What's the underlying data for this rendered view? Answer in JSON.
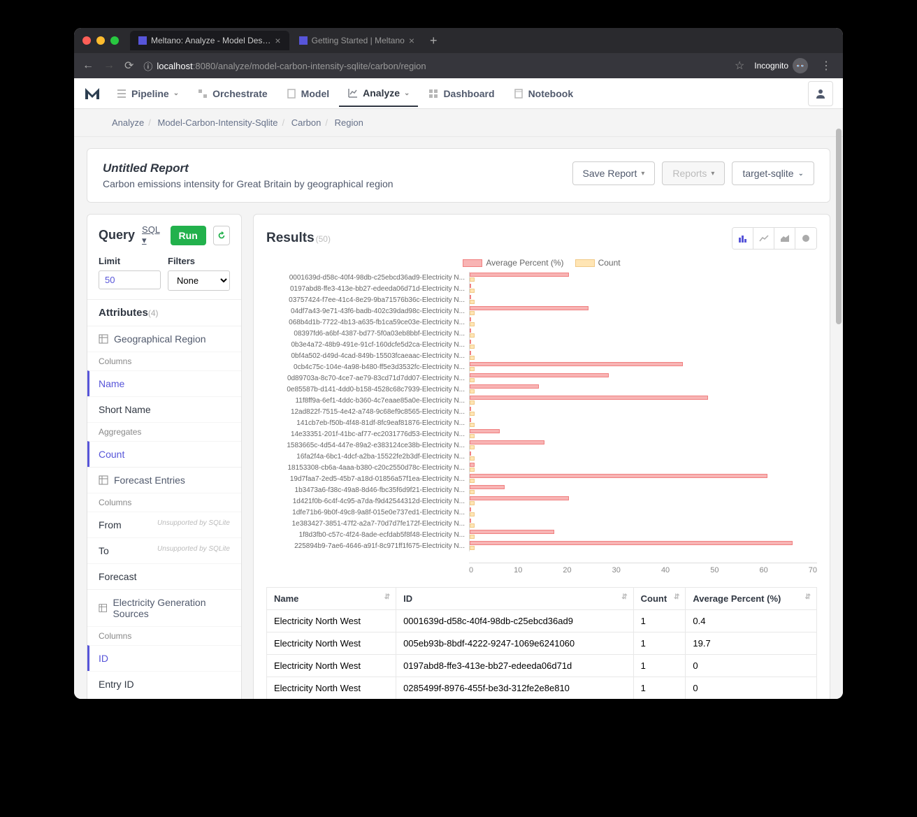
{
  "browser": {
    "tabs": [
      {
        "title": "Meltano: Analyze - Model Des…",
        "active": true
      },
      {
        "title": "Getting Started | Meltano",
        "active": false
      }
    ],
    "url_host": "localhost",
    "url_port": ":8080",
    "url_path": "/analyze/model-carbon-intensity-sqlite/carbon/region",
    "incognito": "Incognito"
  },
  "nav": {
    "pipeline": "Pipeline",
    "orchestrate": "Orchestrate",
    "model": "Model",
    "analyze": "Analyze",
    "dashboard": "Dashboard",
    "notebook": "Notebook"
  },
  "breadcrumb": [
    "Analyze",
    "Model-Carbon-Intensity-Sqlite",
    "Carbon",
    "Region"
  ],
  "report": {
    "title": "Untitled Report",
    "subtitle": "Carbon emissions intensity for Great Britain by geographical region",
    "save": "Save Report",
    "reports": "Reports",
    "target": "target-sqlite"
  },
  "query": {
    "title": "Query",
    "sql": "SQL",
    "run": "Run",
    "limit_label": "Limit",
    "limit_value": "50",
    "filters_label": "Filters",
    "filters_value": "None",
    "attributes_label": "Attributes",
    "attributes_count": "(4)",
    "groups": [
      {
        "title": "Geographical Region",
        "columns_label": "Columns",
        "columns": [
          {
            "name": "Name",
            "selected": true
          },
          {
            "name": "Short Name",
            "selected": false
          }
        ],
        "aggregates_label": "Aggregates",
        "aggregates": [
          {
            "name": "Count",
            "selected": true
          }
        ]
      },
      {
        "title": "Forecast Entries",
        "columns_label": "Columns",
        "columns": [
          {
            "name": "From",
            "unsupported": "Unsupported by SQLite"
          },
          {
            "name": "To",
            "unsupported": "Unsupported by SQLite"
          },
          {
            "name": "Forecast"
          }
        ]
      },
      {
        "title": "Electricity Generation Sources",
        "columns_label": "Columns",
        "columns": [
          {
            "name": "ID",
            "selected": true
          },
          {
            "name": "Entry ID"
          }
        ]
      }
    ]
  },
  "results": {
    "title": "Results",
    "count": "(50)"
  },
  "chart_data": {
    "type": "bar",
    "legend": [
      "Average Percent (%)",
      "Count"
    ],
    "xlim": [
      0,
      70
    ],
    "xticks": [
      0,
      10,
      20,
      30,
      40,
      50,
      60,
      70
    ],
    "rows": [
      {
        "label": "0001639d-d58c-40f4-98db-c25ebcd36ad9-Electricity N...",
        "pct": 20,
        "count": 1
      },
      {
        "label": "0197abd8-ffe3-413e-bb27-edeeda06d71d-Electricity N...",
        "pct": 0,
        "count": 1
      },
      {
        "label": "03757424-f7ee-41c4-8e29-9ba71576b36c-Electricity N...",
        "pct": 0,
        "count": 1
      },
      {
        "label": "04df7a43-9e71-43f6-badb-402c39dad98c-Electricity N...",
        "pct": 24,
        "count": 1
      },
      {
        "label": "068b4d1b-7722-4b13-a635-fb1ca59ce03e-Electricity N...",
        "pct": 0,
        "count": 1
      },
      {
        "label": "08397fd6-a6bf-4387-bd77-5f0a03eb8bbf-Electricity N...",
        "pct": 0,
        "count": 1
      },
      {
        "label": "0b3e4a72-48b9-491e-91cf-160dcfe5d2ca-Electricity N...",
        "pct": 0,
        "count": 1
      },
      {
        "label": "0bf4a502-d49d-4cad-849b-15503fcaeaac-Electricity N...",
        "pct": 0,
        "count": 1
      },
      {
        "label": "0cb4c75c-104e-4a98-b480-ff5e3d3532fc-Electricity N...",
        "pct": 43,
        "count": 1
      },
      {
        "label": "0d89703a-8c70-4ce7-ae79-83cd71d7dd07-Electricity N...",
        "pct": 28,
        "count": 1
      },
      {
        "label": "0e85587b-d141-4dd0-b158-4528c68c7939-Electricity N...",
        "pct": 14,
        "count": 1
      },
      {
        "label": "11f8ff9a-6ef1-4ddc-b360-4c7eaae85a0e-Electricity N...",
        "pct": 48,
        "count": 1
      },
      {
        "label": "12ad822f-7515-4e42-a748-9c68ef9c8565-Electricity N...",
        "pct": 0,
        "count": 1
      },
      {
        "label": "141cb7eb-f50b-4f48-81df-8fc9eaf81876-Electricity N...",
        "pct": 0,
        "count": 1
      },
      {
        "label": "14e33351-201f-41bc-af77-ec2031776d53-Electricity N...",
        "pct": 6,
        "count": 1
      },
      {
        "label": "1583665c-4d54-447e-89a2-e383124ce38b-Electricity N...",
        "pct": 15,
        "count": 1
      },
      {
        "label": "16fa2f4a-6bc1-4dcf-a2ba-15522fe2b3df-Electricity N...",
        "pct": 0,
        "count": 1
      },
      {
        "label": "18153308-cb6a-4aaa-b380-c20c2550d78c-Electricity N...",
        "pct": 1,
        "count": 1
      },
      {
        "label": "19d7faa7-2ed5-45b7-a18d-01856a57f1ea-Electricity N...",
        "pct": 60,
        "count": 1
      },
      {
        "label": "1b3473a6-f38c-49a8-8d46-fbc35f6d9f21-Electricity N...",
        "pct": 7,
        "count": 1
      },
      {
        "label": "1d421f0b-6c4f-4c95-a7da-f9d42544312d-Electricity N...",
        "pct": 20,
        "count": 1
      },
      {
        "label": "1dfe71b6-9b0f-49c8-9a8f-015e0e737ed1-Electricity N...",
        "pct": 0,
        "count": 1
      },
      {
        "label": "1e383427-3851-47f2-a2a7-70d7d7fe172f-Electricity N...",
        "pct": 0,
        "count": 1
      },
      {
        "label": "1f8d3fb0-c57c-4f24-8ade-ecfdab5f8f48-Electricity N...",
        "pct": 17,
        "count": 1
      },
      {
        "label": "225894b9-7ae6-4646-a91f-8c971ff1f675-Electricity N...",
        "pct": 65,
        "count": 1
      }
    ]
  },
  "table": {
    "headers": [
      "Name",
      "ID",
      "Count",
      "Average Percent (%)"
    ],
    "rows": [
      [
        "Electricity North West",
        "0001639d-d58c-40f4-98db-c25ebcd36ad9",
        "1",
        "0.4"
      ],
      [
        "Electricity North West",
        "005eb93b-8bdf-4222-9247-1069e6241060",
        "1",
        "19.7"
      ],
      [
        "Electricity North West",
        "0197abd8-ffe3-413e-bb27-edeeda06d71d",
        "1",
        "0"
      ],
      [
        "Electricity North West",
        "0285499f-8976-455f-be3d-312fe2e8e810",
        "1",
        "0"
      ]
    ]
  }
}
